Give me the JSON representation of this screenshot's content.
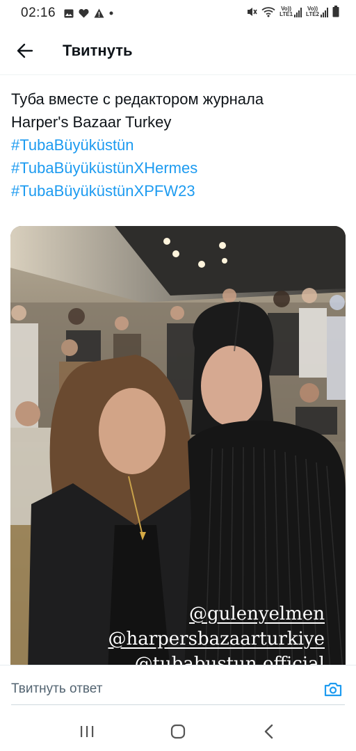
{
  "status_bar": {
    "time": "02:16",
    "left_icons": [
      "image-icon",
      "heart-icon",
      "warning-icon",
      "dot-icon"
    ],
    "right_icons": [
      "mute-icon",
      "wifi-icon",
      "signal-lte1-icon",
      "signal-lte2-icon",
      "battery-icon"
    ],
    "sim1_label_top": "Vo))",
    "sim1_label_bottom": "LTE1",
    "sim2_label_top": "Vo))",
    "sim2_label_bottom": "LTE2"
  },
  "header": {
    "back_icon": "arrow-left-icon",
    "title": "Твитнуть"
  },
  "tweet": {
    "text_lines": [
      "Туба вместе с редактором журнала",
      "Harper's Bazaar Turkey"
    ],
    "hashtags": [
      "#TubaBüyüküstün",
      "#TubaBüyüküstünXHermes",
      "#TubaBüyüküstünXPFW23"
    ],
    "media": {
      "overlay_mentions": [
        "@gulenyelmen",
        "@harpersbazaarturkiye",
        "@tubabustun.official"
      ]
    }
  },
  "reply": {
    "placeholder": "Твитнуть ответ",
    "camera_icon": "camera-icon"
  },
  "nav": {
    "icons": [
      "recent-apps-icon",
      "home-icon",
      "back-icon"
    ]
  },
  "colors": {
    "accent": "#1d9bf0",
    "text": "#0f1419",
    "muted": "#536471"
  }
}
